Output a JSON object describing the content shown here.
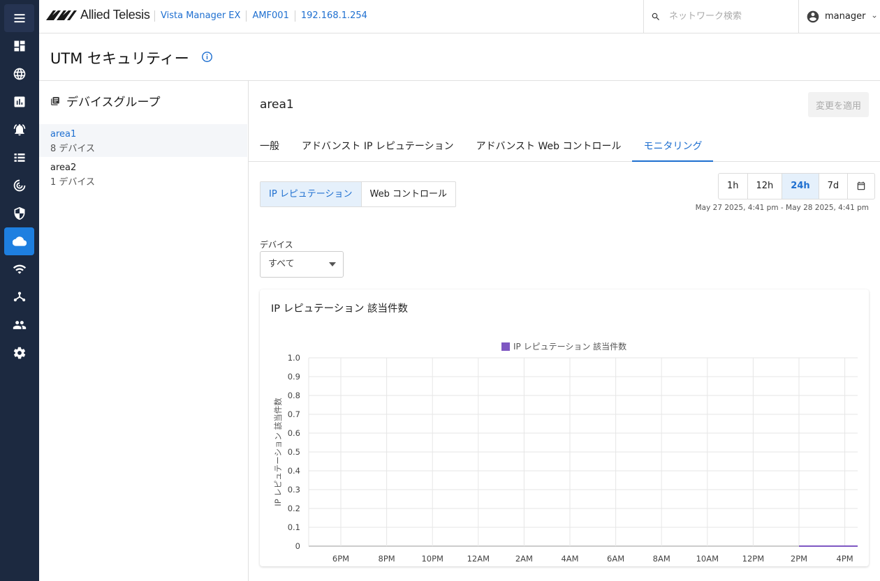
{
  "header": {
    "brand": "Allied Telesis",
    "breadcrumbs": [
      "Vista Manager EX",
      "AMF001",
      "192.168.1.254"
    ],
    "search_placeholder": "ネットワーク検索",
    "user": "manager"
  },
  "sidebar": {
    "icons": [
      "menu-icon",
      "dashboard-icon",
      "globe-icon",
      "chart-icon",
      "alarm-icon",
      "list-icon",
      "radar-icon",
      "shield-icon",
      "cloud-icon",
      "wifi-icon",
      "topology-icon",
      "users-icon",
      "gear-icon"
    ],
    "active": "cloud-icon"
  },
  "page": {
    "title": "UTM セキュリティー"
  },
  "device_groups": {
    "heading": "デバイスグループ",
    "items": [
      {
        "name": "area1",
        "count": "8 デバイス",
        "selected": true
      },
      {
        "name": "area2",
        "count": "1 デバイス",
        "selected": false
      }
    ]
  },
  "main": {
    "title": "area1",
    "apply_label": "変更を適用",
    "tabs": [
      "一般",
      "アドバンスト IP レピュテーション",
      "アドバンスト Web コントロール",
      "モニタリング"
    ],
    "active_tab": 3,
    "segments": [
      "IP レピュテーション",
      "Web コントロール"
    ],
    "ranges": [
      "1h",
      "12h",
      "24h",
      "7d"
    ],
    "active_range": "24h",
    "range_text": "May 27 2025, 4:41 pm - May 28 2025, 4:41 pm",
    "device_label": "デバイス",
    "device_value": "すべて",
    "card_title": "IP レピュテーション 該当件数"
  },
  "chart_data": {
    "type": "line",
    "legend": "IP レピュテーション 該当件数",
    "ylabel": "IP レピュテーション 該当件数",
    "ylim": [
      0,
      1
    ],
    "yticks": [
      "1.0",
      "0.9",
      "0.8",
      "0.7",
      "0.6",
      "0.5",
      "0.4",
      "0.3",
      "0.2",
      "0.1",
      "0"
    ],
    "xticks": [
      "6PM",
      "8PM",
      "10PM",
      "12AM",
      "2AM",
      "4AM",
      "6AM",
      "8AM",
      "10AM",
      "12PM",
      "2PM",
      "4PM"
    ],
    "series": [
      {
        "name": "IP レピュテーション 該当件数",
        "color": "#7e57c2",
        "points": [
          {
            "x": "2:41PM",
            "y": 0
          },
          {
            "x": "4:41PM",
            "y": 0
          }
        ]
      }
    ]
  }
}
